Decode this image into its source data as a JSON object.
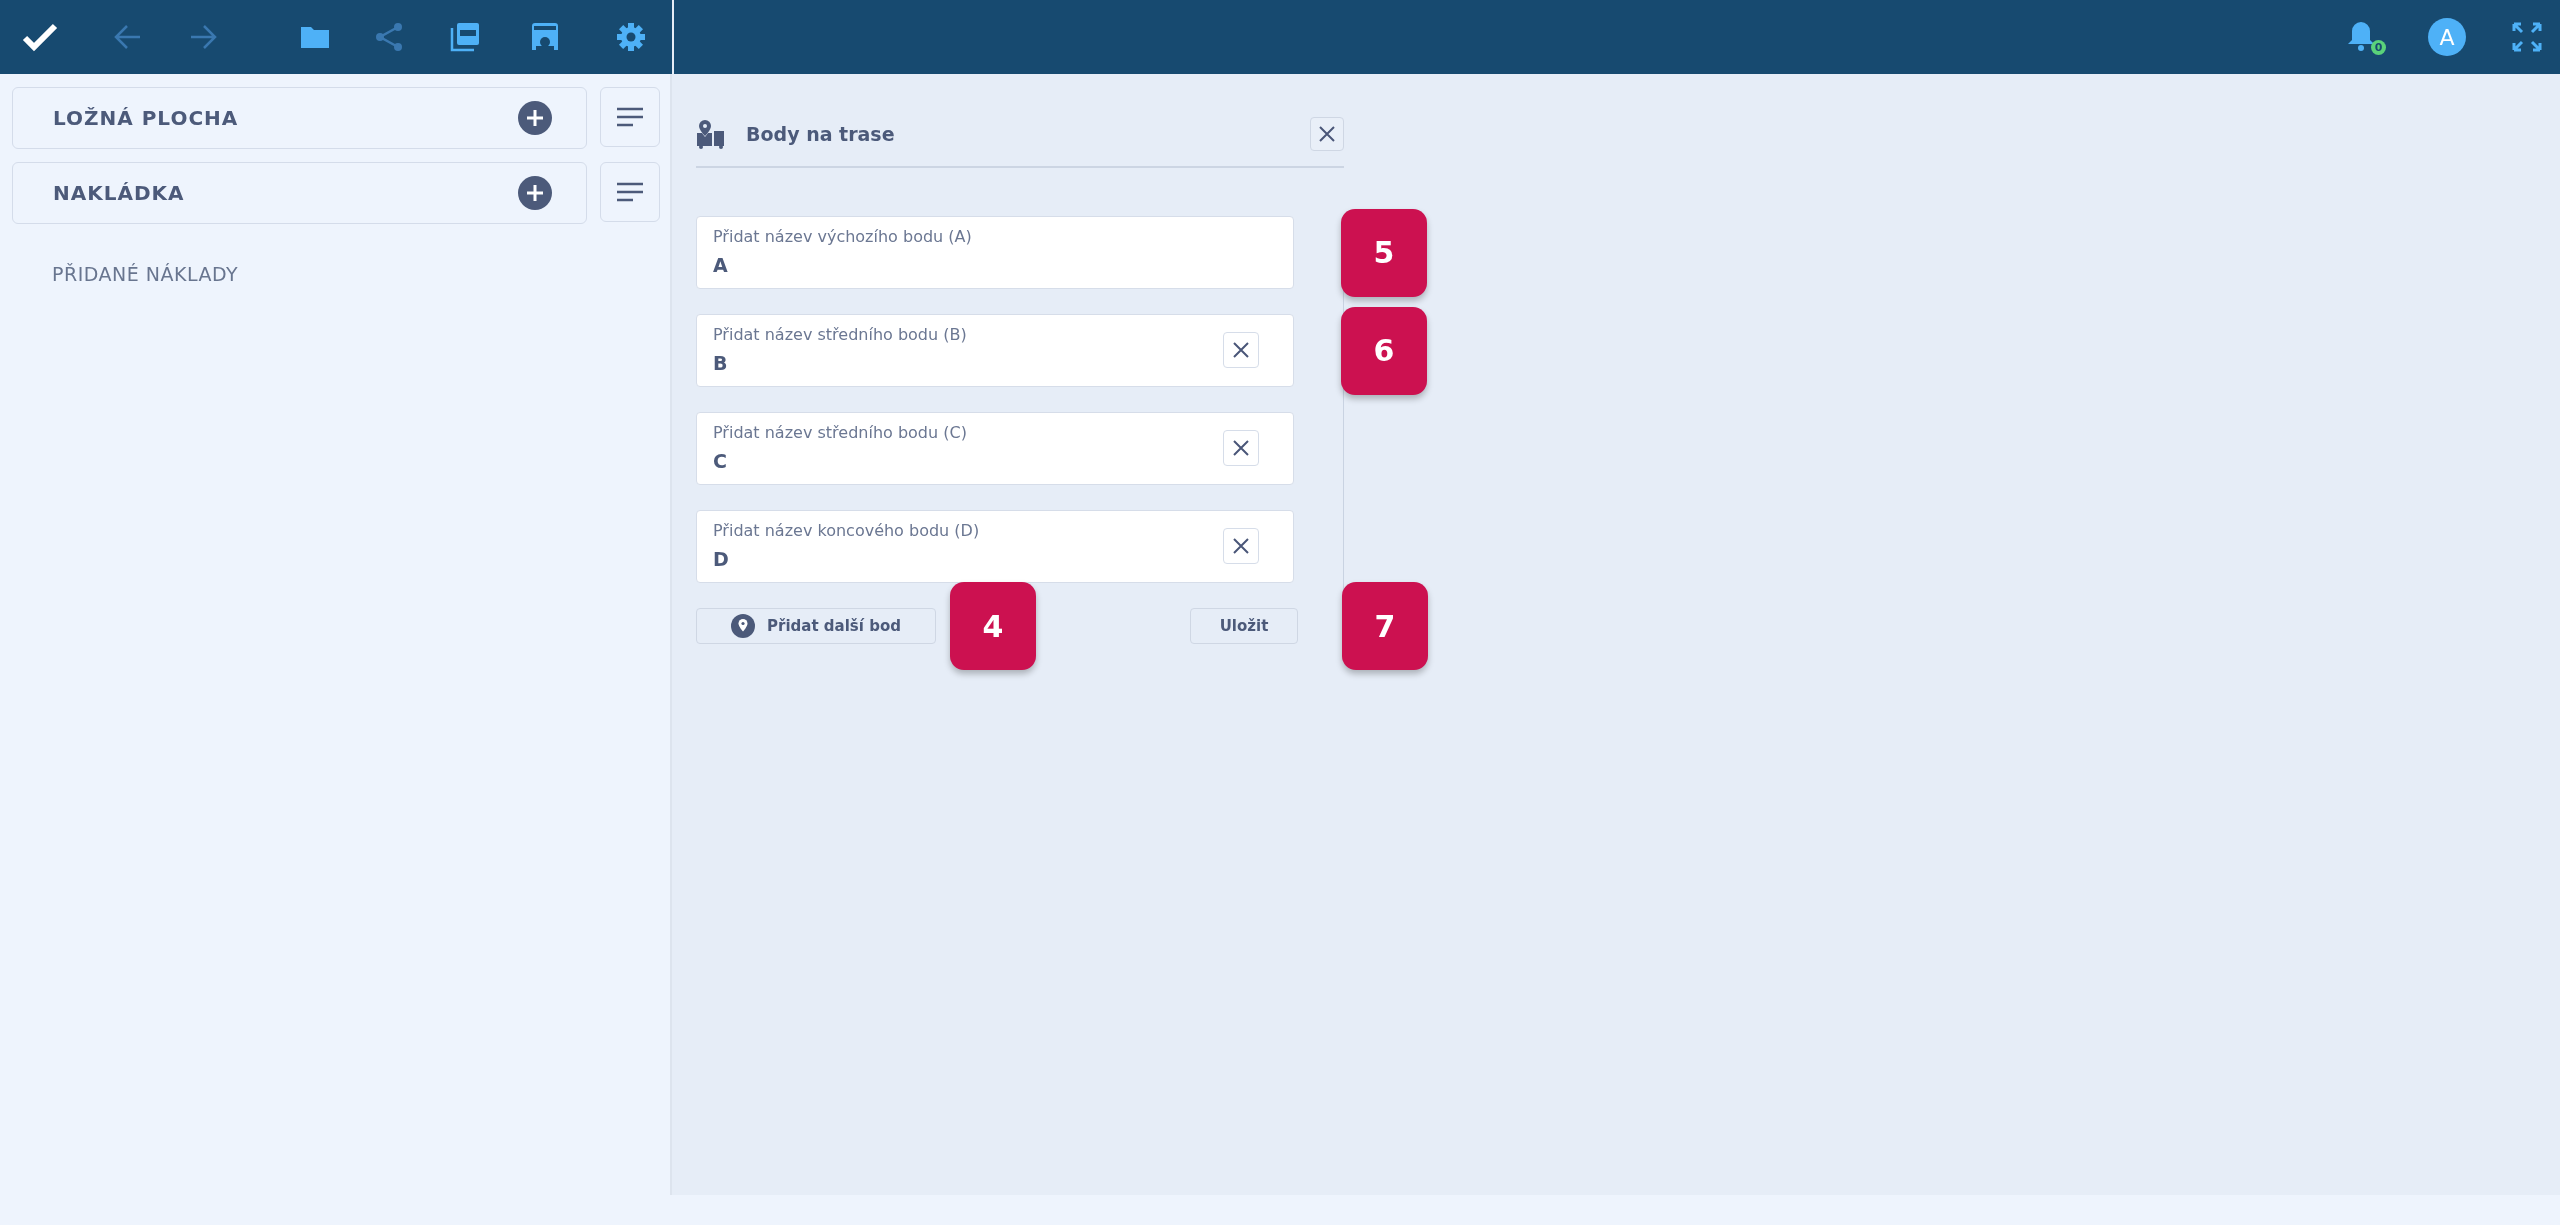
{
  "top_bar": {
    "notification_count": "0",
    "avatar": "A"
  },
  "sidebar": {
    "sections": [
      {
        "title": "LOŽNÁ PLOCHA"
      },
      {
        "title": "NAKLÁDKA"
      }
    ],
    "footer_label": "PŘIDANÉ NÁKLADY"
  },
  "dialog": {
    "title": "Body na trase",
    "fields": [
      {
        "label": "Přidat název výchozího bodu (A)",
        "value": "A",
        "removable": false,
        "badge": "5"
      },
      {
        "label": "Přidat název středního bodu (B)",
        "value": "B",
        "removable": true,
        "badge": "6"
      },
      {
        "label": "Přidat název středního bodu (C)",
        "value": "C",
        "removable": true
      },
      {
        "label": "Přidat název koncového bodu (D)",
        "value": "D",
        "removable": true
      }
    ],
    "add_button": {
      "label": "Přidat další bod",
      "badge": "4"
    },
    "save_button": {
      "label": "Uložit",
      "badge": "7"
    }
  }
}
